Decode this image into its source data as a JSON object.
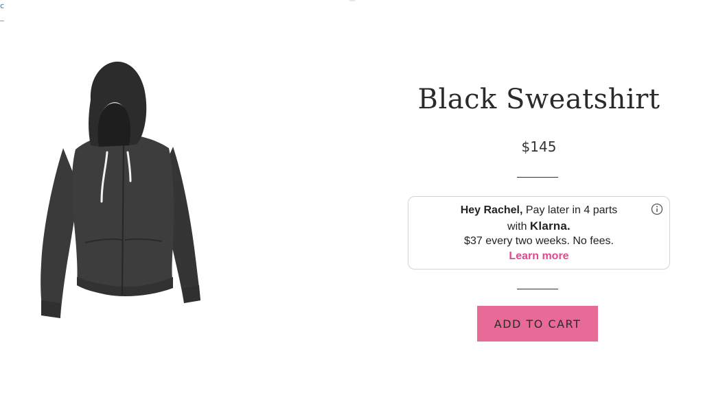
{
  "corner_text": "c",
  "product": {
    "image_alt": "Black Sweatshirt",
    "title": "Black Sweatshirt",
    "price": "$145"
  },
  "klarna": {
    "greeting": "Hey Rachel,",
    "line1_rest": "Pay later in 4 parts",
    "with": "with",
    "brand": "Klarna.",
    "terms": "$37 every two weeks. No fees.",
    "learn_more": "Learn more"
  },
  "cart": {
    "add_label": "ADD TO CART"
  },
  "icons": {
    "info": "info-icon"
  },
  "colors": {
    "accent_pink": "#e86a96",
    "link_pink": "#e0498f"
  }
}
